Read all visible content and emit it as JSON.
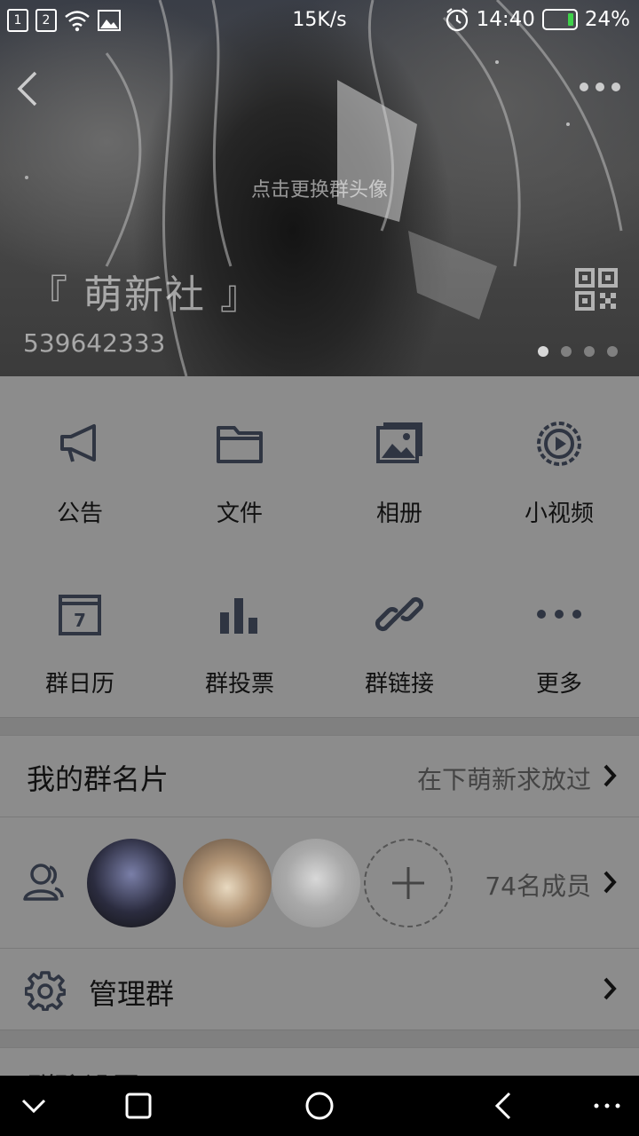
{
  "status_bar": {
    "sim1": "1",
    "sim2": "2",
    "net_speed": "15K/s",
    "time": "14:40",
    "battery": "24%"
  },
  "header": {
    "avatar_tip": "点击更换群头像",
    "group_name": "『 萌新社 』",
    "group_id": "539642333",
    "carousel_pages": 4,
    "carousel_active": 0
  },
  "features": [
    {
      "label": "公告",
      "icon": "announcement-icon"
    },
    {
      "label": "文件",
      "icon": "folder-icon"
    },
    {
      "label": "相册",
      "icon": "album-icon"
    },
    {
      "label": "小视频",
      "icon": "video-icon"
    },
    {
      "label": "群日历",
      "icon": "calendar-icon"
    },
    {
      "label": "群投票",
      "icon": "vote-icon"
    },
    {
      "label": "群链接",
      "icon": "link-icon"
    },
    {
      "label": "更多",
      "icon": "more-dots-icon"
    }
  ],
  "calendar_day": "7",
  "group_card": {
    "title": "我的群名片",
    "value": "在下萌新求放过"
  },
  "members": {
    "count_label": "74名成员"
  },
  "manage": {
    "title": "管理群"
  },
  "partial_row": {
    "title": "群聊设置"
  },
  "colors": {
    "overlay_gray": "#8c8c8c",
    "icon_dark": "#2f3542",
    "battery_green": "#3fd14a"
  }
}
